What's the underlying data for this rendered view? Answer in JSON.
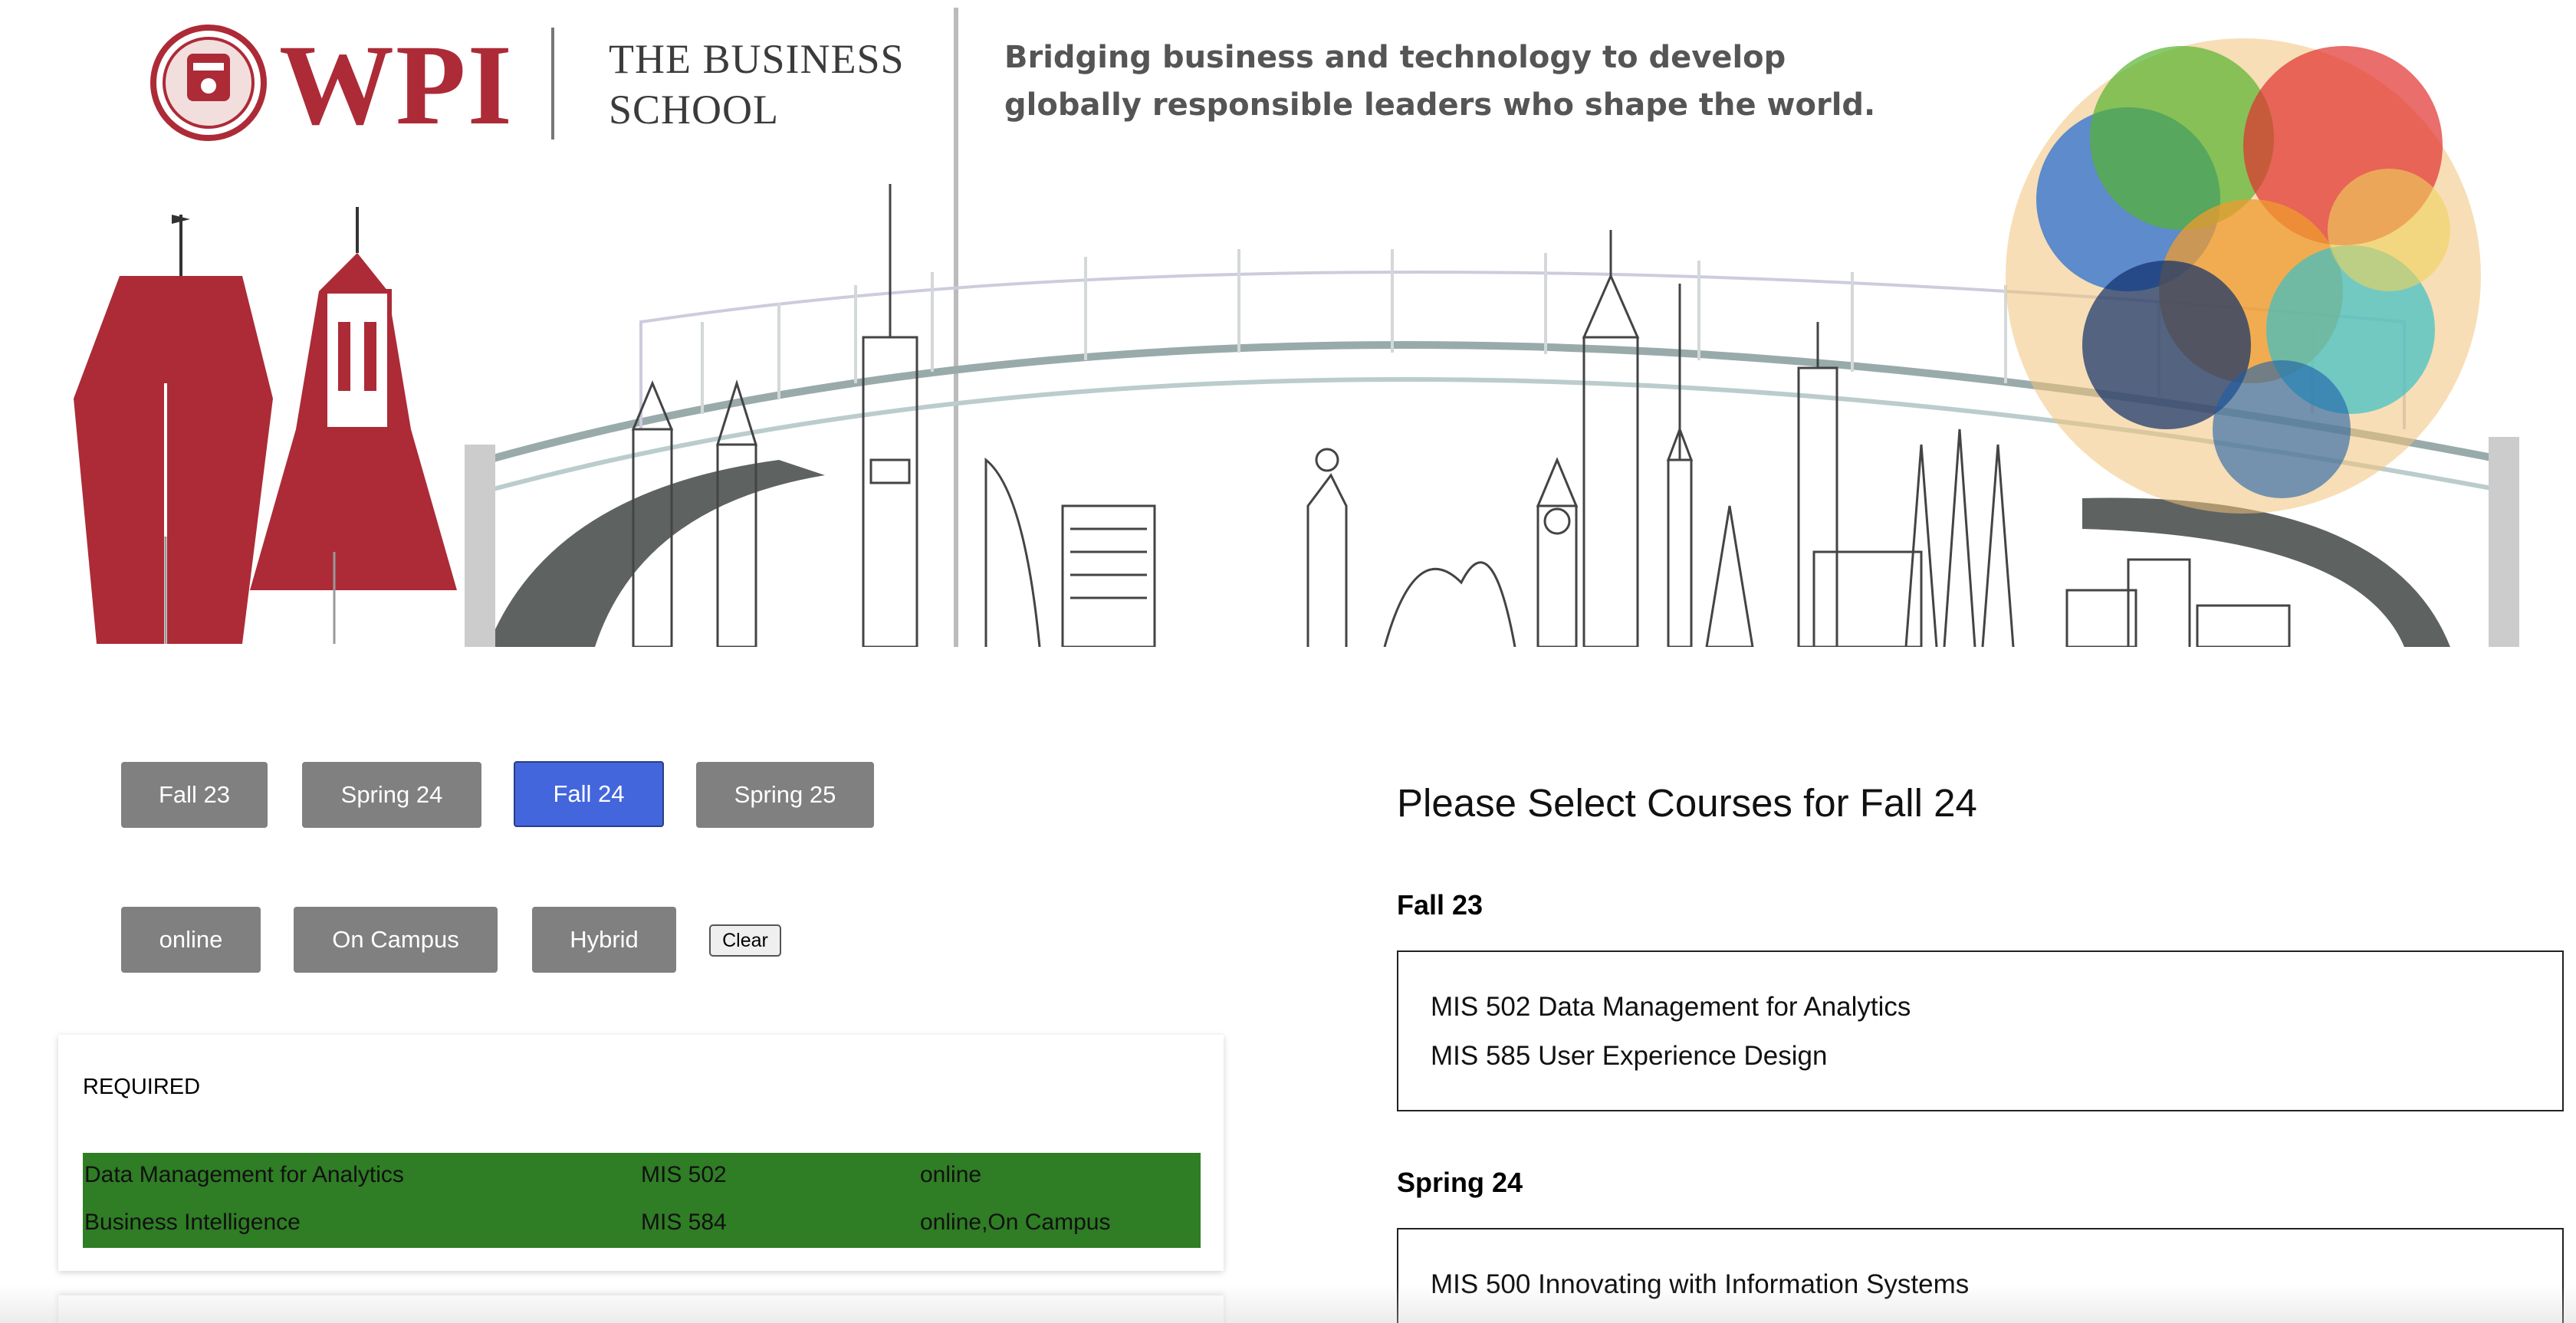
{
  "banner": {
    "logo_word": "WPI",
    "school_line1": "THE BUSINESS",
    "school_line2": "SCHOOL",
    "tagline_line1": "Bridging business and technology to develop",
    "tagline_line2": "globally responsible leaders who shape the world."
  },
  "colors": {
    "brand_red": "#ac2b37",
    "button_gray": "#808080",
    "button_active": "#4466dd",
    "required_green": "#2f7d25"
  },
  "terms": [
    "Fall 23",
    "Spring 24",
    "Fall 24",
    "Spring 25"
  ],
  "active_term": "Fall 24",
  "modes": [
    "online",
    "On Campus",
    "Hybrid"
  ],
  "clear_label": "Clear",
  "required": {
    "title": "REQUIRED",
    "rows": [
      {
        "name": "Data Management for Analytics",
        "code": "MIS 502",
        "mode": "online"
      },
      {
        "name": "Business Intelligence",
        "code": "MIS 584",
        "mode": "online,On Campus"
      }
    ]
  },
  "selection": {
    "heading": "Please Select Courses for Fall 24",
    "groups": [
      {
        "term": "Fall 23",
        "courses": [
          "MIS 502 Data Management for Analytics",
          "MIS 585 User Experience Design"
        ]
      },
      {
        "term": "Spring 24",
        "courses": [
          "MIS 500 Innovating with Information Systems"
        ]
      }
    ]
  }
}
